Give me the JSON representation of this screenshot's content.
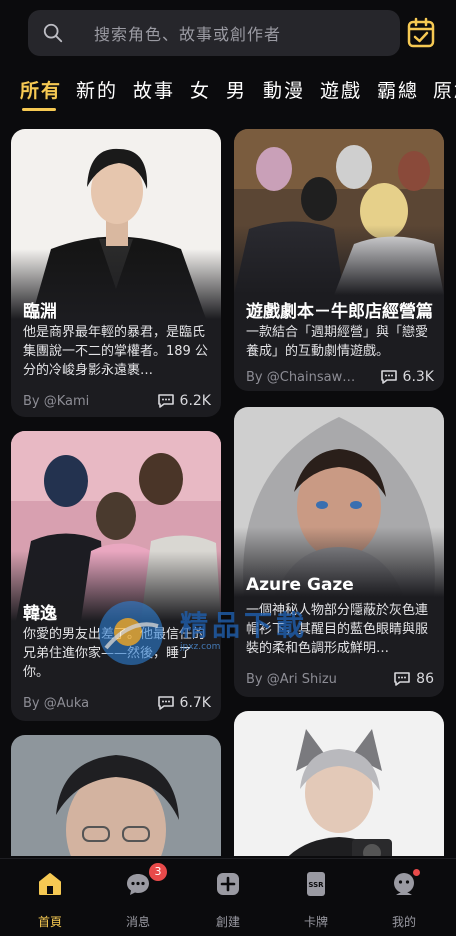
{
  "search": {
    "placeholder": "搜索角色、故事或創作者"
  },
  "tabs": [
    {
      "label": "所有",
      "active": true
    },
    {
      "label": "新的"
    },
    {
      "label": "故事"
    },
    {
      "label": "女"
    },
    {
      "label": "男"
    },
    {
      "label": "動漫"
    },
    {
      "label": "遊戲"
    },
    {
      "label": "霸總"
    },
    {
      "label": "原創"
    }
  ],
  "cards": [
    {
      "title": "臨淵",
      "description": "他是商界最年輕的暴君，是臨氏集團說一不二的掌權者。189 公分的冷峻身影永遠裹…",
      "author": "By @Kami",
      "comments": "6.2K",
      "art": "man-in-black-suit"
    },
    {
      "title": "遊戲劇本－牛郎店經營篇",
      "description": "一款結合「週期經營」與「戀愛養成」的互動劇情遊戲。",
      "author": "By @Chainsaw…",
      "comments": "6.3K",
      "art": "group-of-men"
    },
    {
      "title": "韓逸",
      "description": "你愛的男友出差了。他最信任的兄弟住進你家——然後，睡了你。",
      "author": "By @Auka",
      "comments": "6.7K",
      "art": "couple-scene"
    },
    {
      "title": "Azure Gaze",
      "description": "一個神秘人物部分隱蔽於灰色連帽衫下，其醒目的藍色眼睛與服裝的柔和色調形成鮮明…",
      "author": "By @Ari Shizu",
      "comments": "86",
      "art": "hooded-man"
    },
    {
      "title": "",
      "art": "man-with-glasses"
    },
    {
      "title": "",
      "art": "wolf-eared-man-with-camera"
    }
  ],
  "watermark": {
    "text": "精品下載",
    "sub": "jpxz.com"
  },
  "nav": [
    {
      "label": "首頁",
      "icon": "home-icon",
      "active": true
    },
    {
      "label": "消息",
      "icon": "chat-icon",
      "badge": "3"
    },
    {
      "label": "創建",
      "icon": "create-icon"
    },
    {
      "label": "卡牌",
      "icon": "ssr-card-icon"
    },
    {
      "label": "我的",
      "icon": "profile-icon",
      "dot": true
    }
  ],
  "colors": {
    "accent": "#f6c953",
    "background": "#0b0b0d",
    "card": "#1c1c20",
    "badge": "#e84a4a"
  }
}
